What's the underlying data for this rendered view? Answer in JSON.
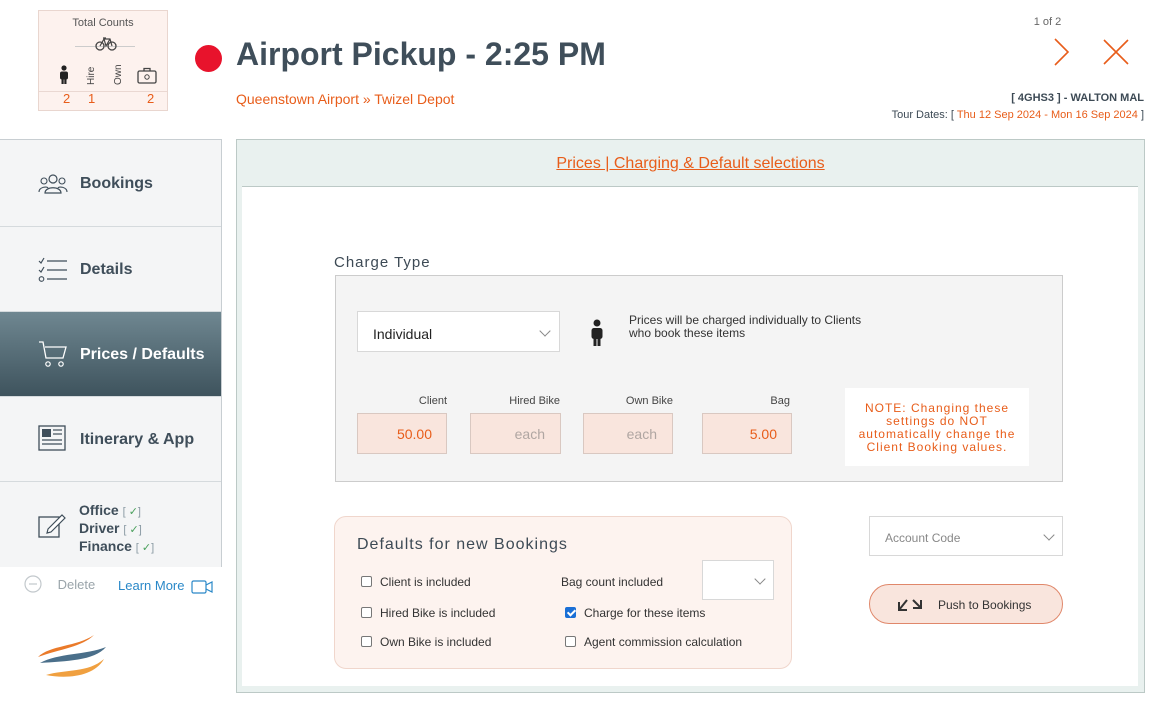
{
  "counts": {
    "title": "Total Counts",
    "col_labels": [
      "Hire",
      "Own"
    ],
    "values": [
      "2",
      "1",
      "2"
    ]
  },
  "header": {
    "title": "Airport Pickup - 2:25 PM",
    "route": "Queenstown Airport » Twizel Depot",
    "pager": "1 of 2",
    "tour_ref": "[ 4GHS3 ] - WALTON MAL",
    "tour_dates_label": "Tour Dates: [",
    "tour_start": "Thu 12 Sep 2024",
    "tour_sep": "-",
    "tour_end": "Mon 16 Sep 2024",
    "tour_close": "]",
    "status_color": "#e8132c"
  },
  "sidebar": {
    "items": [
      {
        "label": "Bookings",
        "icon": "people-icon"
      },
      {
        "label": "Details",
        "icon": "checklist-icon"
      },
      {
        "label": "Prices / Defaults",
        "icon": "cart-icon"
      },
      {
        "label": "Itinerary & App",
        "icon": "newspaper-icon"
      }
    ],
    "roles": [
      {
        "label": "Office",
        "bracket_open": "[",
        "check": "✓",
        "bracket_close": "]"
      },
      {
        "label": "Driver",
        "bracket_open": "[",
        "check": "✓",
        "bracket_close": "]"
      },
      {
        "label": "Finance",
        "bracket_open": "[",
        "check": "✓",
        "bracket_close": "]"
      }
    ],
    "delete_label": "Delete",
    "learn_more_label": "Learn More"
  },
  "main": {
    "title": "Prices | Charging & Default selections",
    "charge_type_title": "Charge Type",
    "charge_type_value": "Individual",
    "charge_desc_line1": "Prices will be charged individually to Clients",
    "charge_desc_line2": "who book these items",
    "prices": [
      {
        "label": "Client",
        "value": "50.00",
        "placeholder": ""
      },
      {
        "label": "Hired Bike",
        "value": "",
        "placeholder": "each"
      },
      {
        "label": "Own Bike",
        "value": "",
        "placeholder": "each"
      },
      {
        "label": "Bag",
        "value": "5.00",
        "placeholder": ""
      }
    ],
    "note_lines": [
      "NOTE: Changing these",
      "settings do NOT",
      "automatically change the",
      "Client Booking values."
    ],
    "defaults_title": "Defaults for new Bookings",
    "defaults": {
      "client_included": {
        "label": "Client is included",
        "checked": false
      },
      "hired_bike_included": {
        "label": "Hired Bike is included",
        "checked": false
      },
      "own_bike_included": {
        "label": "Own  Bike is included",
        "checked": false
      },
      "charge_items": {
        "label": "Charge for these items",
        "checked": true
      },
      "agent_commission": {
        "label": "Agent commission calculation",
        "checked": false
      }
    },
    "bag_count_label": "Bag count included",
    "bag_count_value": "",
    "account_code_placeholder": "Account Code",
    "push_button_label": "Push to Bookings",
    "accent_color": "#e85d1a"
  }
}
